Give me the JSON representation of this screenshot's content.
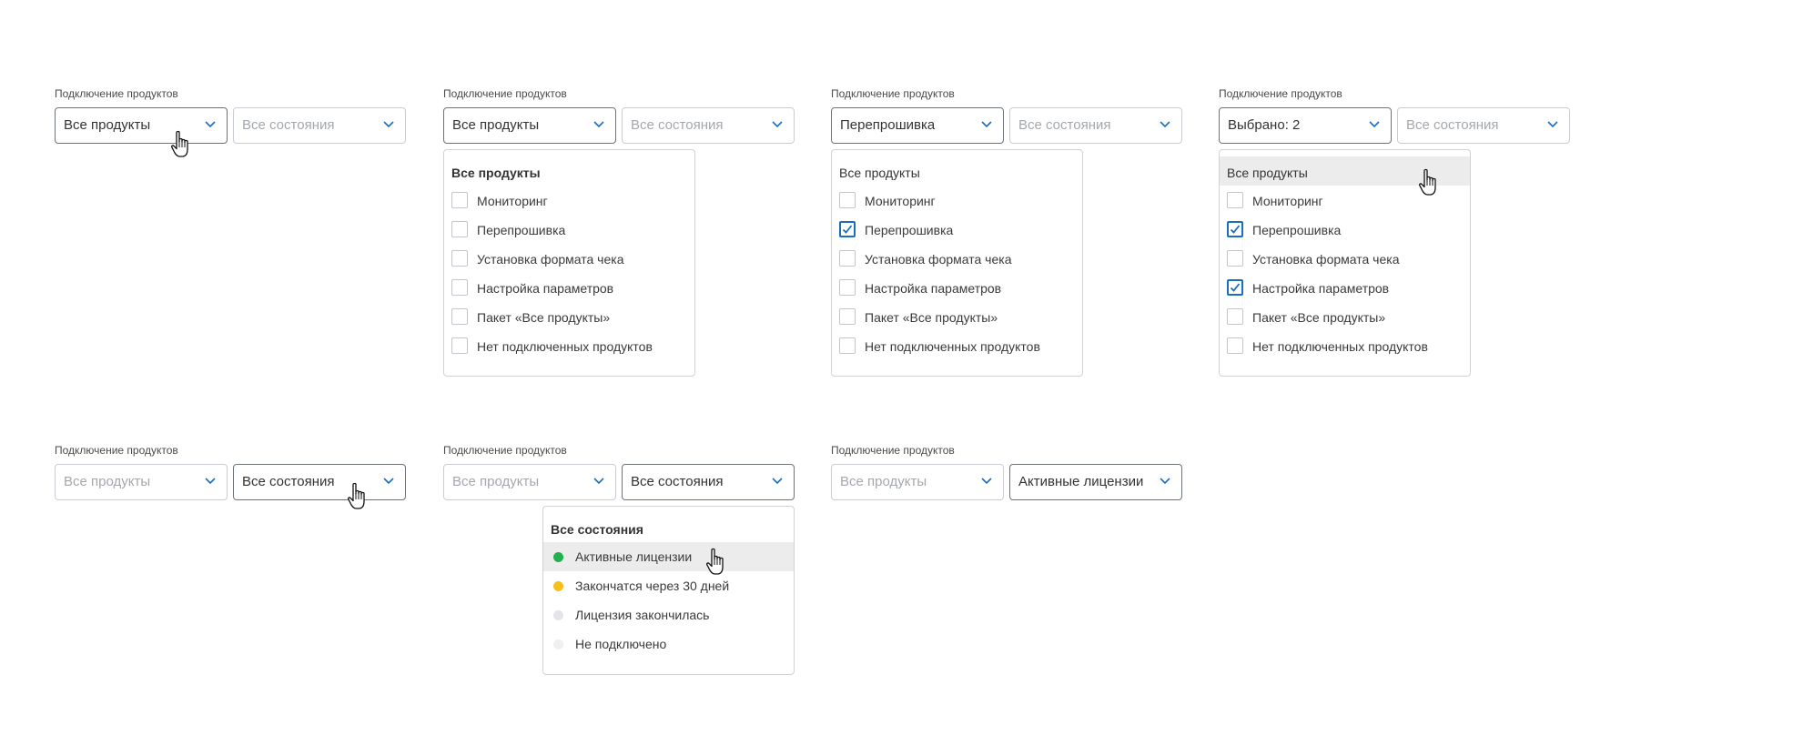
{
  "common": {
    "label": "Подключение продуктов",
    "products_placeholder": "Все продукты",
    "states_placeholder": "Все состояния"
  },
  "products_dropdown": {
    "header": "Все продукты",
    "options": [
      "Мониторинг",
      "Перепрошивка",
      "Установка формата чека",
      "Настройка параметров",
      "Пакет «Все продукты»",
      "Нет подключенных продуктов"
    ]
  },
  "states_dropdown": {
    "header": "Все состояния",
    "options": [
      {
        "label": "Активные лицензии",
        "color": "#22b14c"
      },
      {
        "label": "Закончатся через 30 дней",
        "color": "#f5bf1c"
      },
      {
        "label": "Лицензия закончилась",
        "color": "#e3e5e8"
      },
      {
        "label": "Не подключено",
        "color": "#eeeff1"
      }
    ]
  },
  "variants": [
    {
      "products_value": "Все продукты",
      "states_value": "Все состояния"
    },
    {
      "products_value": "Все продукты",
      "states_value": "Все состояния",
      "checked": [
        false,
        false,
        false,
        false,
        false,
        false
      ]
    },
    {
      "products_value": "Перепрошивка",
      "states_value": "Все состояния",
      "checked": [
        false,
        true,
        false,
        false,
        false,
        false
      ]
    },
    {
      "products_value": "Выбрано: 2",
      "states_value": "Все состояния",
      "checked": [
        false,
        true,
        false,
        true,
        false,
        false
      ]
    },
    {
      "products_value": "Все продукты",
      "states_value": "Все состояния"
    },
    {
      "products_value": "Все продукты",
      "states_value": "Все состояния"
    },
    {
      "products_value": "Все продукты",
      "states_value": "Активные лицензии"
    }
  ],
  "colors": {
    "accent": "#1a6ec2",
    "hover_bg": "#ececec",
    "border": "#c9cdd2"
  },
  "icons": {
    "chevron": "chevron-down-icon",
    "cursor": "hand-pointer-cursor-icon",
    "check": "checkmark-icon"
  }
}
